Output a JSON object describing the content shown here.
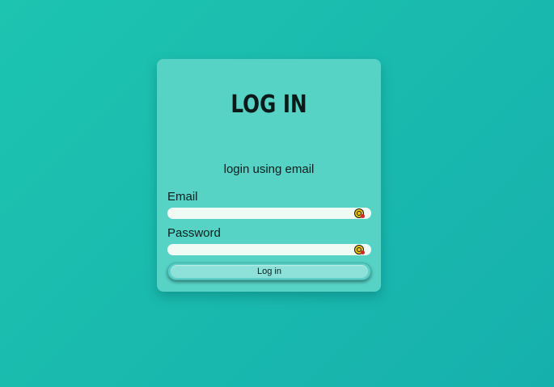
{
  "login_card": {
    "title": "LOG IN",
    "subtitle": "login using email",
    "email_label": "Email",
    "email_value": "",
    "password_label": "Password",
    "password_value": "",
    "field_icon": "password-manager-icon",
    "submit_label": "Log in"
  },
  "colors": {
    "background": "#1dc4b0",
    "card": "#56d3c5",
    "field": "#f1fbf5",
    "button": "#8ee1d8"
  }
}
